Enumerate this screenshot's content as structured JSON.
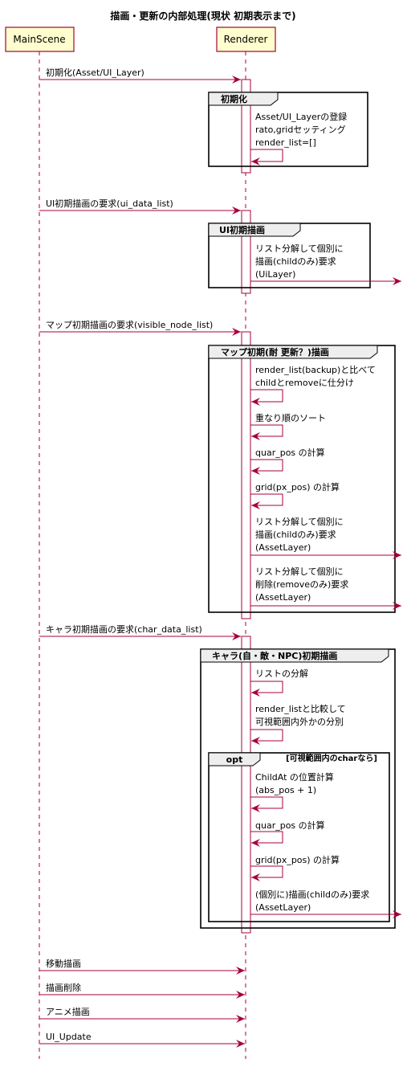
{
  "title": "描画・更新の内部処理(現状 初期表示まで)",
  "participants": {
    "main_scene": "MainScene",
    "renderer": "Renderer"
  },
  "colors": {
    "arrow": "#A80036",
    "participant_fill": "#FEFECE",
    "participant_border": "#A80036",
    "activation_fill": "#FFFFFF"
  },
  "messages": {
    "init": "初期化(Asset/UI_Layer)",
    "ui_init": "UI初期描画の要求(ui_data_list)",
    "map_init": "マップ初期描画の要求(visible_node_list)",
    "chara_init": "キャラ初期描画の要求(char_data_list)",
    "move": "移動描画",
    "delete": "描画削除",
    "anime": "アニメ描画",
    "ui_update": "UI_Update"
  },
  "groups": {
    "init": {
      "label": "初期化",
      "steps": [
        [
          "Asset/UI_Layerの登録",
          "rato,gridセッティング",
          "render_list=[]"
        ]
      ]
    },
    "ui": {
      "label": "UI初期描画",
      "steps": [
        [
          "リスト分解して個別に",
          "描画(childのみ)要求",
          "(UiLayer)"
        ]
      ]
    },
    "map": {
      "label": "マップ初期(耐 更新？)描画",
      "steps": [
        [
          "render_list(backup)と比べて",
          "childとremoveに仕分け"
        ],
        [
          "重なり順のソート"
        ],
        [
          "quar_pos の計算"
        ],
        [
          "grid(px_pos) の計算"
        ],
        [
          "リスト分解して個別に",
          "描画(childのみ)要求",
          "(AssetLayer)"
        ],
        [
          "リスト分解して個別に",
          "削除(removeのみ)要求",
          "(AssetLayer)"
        ]
      ]
    },
    "chara": {
      "label": "キャラ(自・敵・NPC)初期描画",
      "steps": [
        [
          "リストの分解"
        ],
        [
          "render_listと比較して",
          "可視範囲内外かの分別"
        ]
      ],
      "opt": {
        "label": "opt",
        "condition": "[可視範囲内のcharなら]",
        "steps": [
          [
            "ChildAt の位置計算",
            "(abs_pos + 1)"
          ],
          [
            "quar_pos の計算"
          ],
          [
            "grid(px_pos) の計算"
          ],
          [
            "(個別に)描画(childのみ)要求",
            "(AssetLayer)"
          ]
        ]
      }
    }
  }
}
